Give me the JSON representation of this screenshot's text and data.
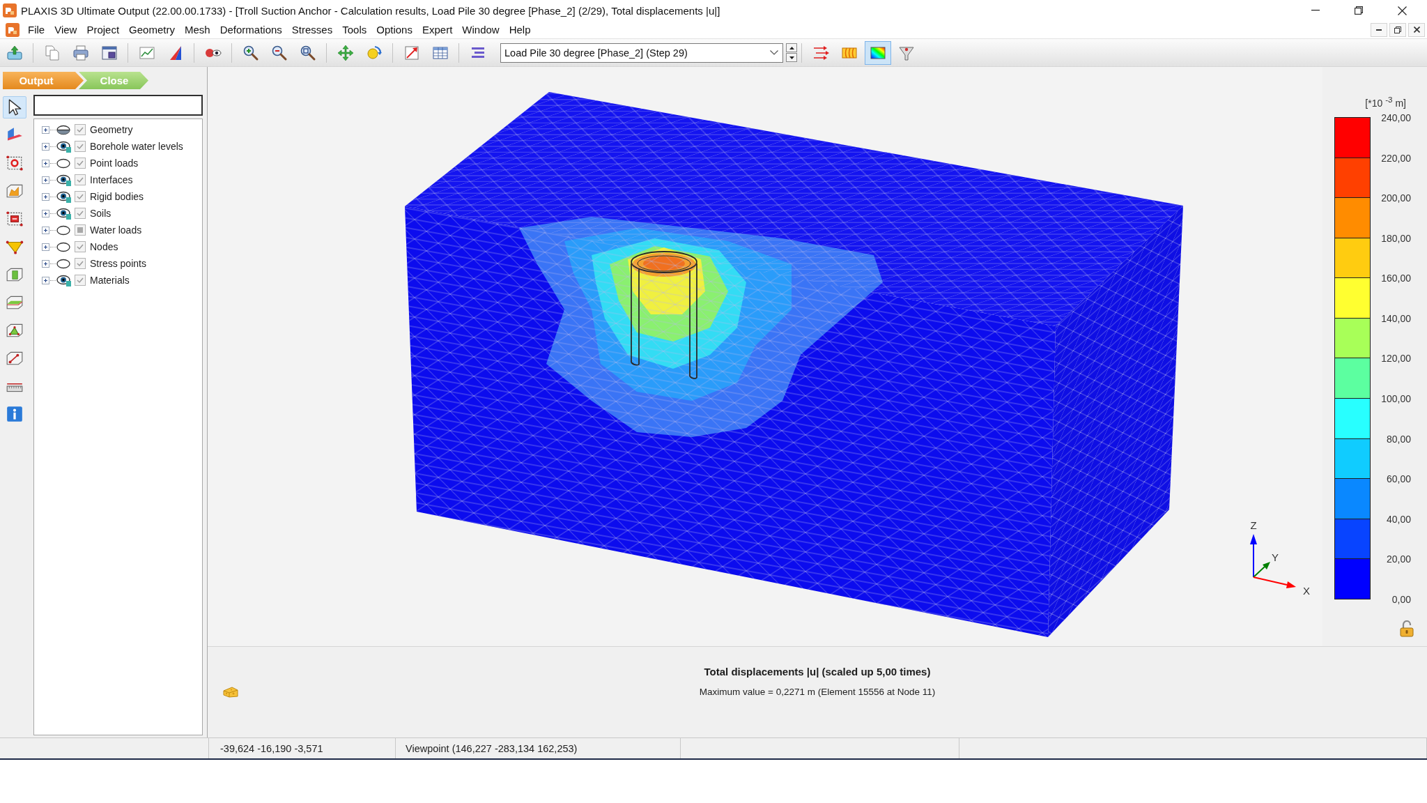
{
  "window": {
    "title": "PLAXIS 3D Ultimate Output (22.00.00.1733) - [Troll Suction Anchor - Calculation results, Load Pile 30 degree [Phase_2] (2/29), Total displacements |u|]"
  },
  "menu": [
    "File",
    "View",
    "Project",
    "Geometry",
    "Mesh",
    "Deformations",
    "Stresses",
    "Tools",
    "Options",
    "Expert",
    "Window",
    "Help"
  ],
  "toolbar": {
    "step_dropdown": {
      "value": "Load Pile 30 degree [Phase_2] (Step 29)"
    },
    "result_tools": [
      {
        "pressed": false
      },
      {
        "pressed": false
      },
      {
        "pressed": true
      },
      {
        "pressed": false
      }
    ]
  },
  "breadcrumb": [
    {
      "label": "Output",
      "selected": true
    },
    {
      "label": "Close",
      "selected": false
    }
  ],
  "side_tools": [
    {
      "selected": true
    },
    {
      "selected": false
    },
    {
      "selected": false
    },
    {
      "selected": false
    },
    {
      "selected": false
    },
    {
      "selected": false
    },
    {
      "selected": false
    },
    {
      "selected": false
    },
    {
      "selected": false
    },
    {
      "selected": false
    },
    {
      "selected": false
    },
    {
      "selected": false
    }
  ],
  "tree": {
    "items": [
      {
        "label": "Geometry",
        "expanded": false,
        "visible": false,
        "partial": true,
        "checked": true,
        "indeterminate": false
      },
      {
        "label": "Borehole water levels",
        "expanded": false,
        "visible": true,
        "partial": false,
        "checked": true,
        "indeterminate": false
      },
      {
        "label": "Point loads",
        "expanded": false,
        "visible": false,
        "partial": false,
        "checked": true,
        "indeterminate": false
      },
      {
        "label": "Interfaces",
        "expanded": false,
        "visible": true,
        "partial": false,
        "checked": true,
        "indeterminate": false
      },
      {
        "label": "Rigid bodies",
        "expanded": false,
        "visible": true,
        "partial": false,
        "checked": true,
        "indeterminate": false
      },
      {
        "label": "Soils",
        "expanded": false,
        "visible": true,
        "partial": false,
        "checked": true,
        "indeterminate": false
      },
      {
        "label": "Water loads",
        "expanded": false,
        "visible": false,
        "partial": false,
        "checked": false,
        "indeterminate": true
      },
      {
        "label": "Nodes",
        "expanded": false,
        "visible": false,
        "partial": false,
        "checked": true,
        "indeterminate": false
      },
      {
        "label": "Stress points",
        "expanded": false,
        "visible": false,
        "partial": false,
        "checked": true,
        "indeterminate": false
      },
      {
        "label": "Materials",
        "expanded": false,
        "visible": true,
        "partial": false,
        "checked": true,
        "indeterminate": false
      }
    ]
  },
  "viewport": {
    "axes": [
      {
        "label": "Z",
        "color": "#0000ff"
      },
      {
        "label": "Y",
        "color": "#008000"
      },
      {
        "label": "X",
        "color": "#ff0000"
      }
    ]
  },
  "legend": {
    "unit": "[*10 $^{-3}$ m]",
    "bands": [
      {
        "color": "#ff0000"
      },
      {
        "color": "#ff4000"
      },
      {
        "color": "#ff8c00"
      },
      {
        "color": "#ffcc10"
      },
      {
        "color": "#ffff30"
      },
      {
        "color": "#a8ff58"
      },
      {
        "color": "#5cffa0"
      },
      {
        "color": "#28ffff"
      },
      {
        "color": "#10ccff"
      },
      {
        "color": "#0a88ff"
      },
      {
        "color": "#0844ff"
      },
      {
        "color": "#0000ff"
      }
    ],
    "ticks": [
      "240,00",
      "220,00",
      "200,00",
      "180,00",
      "160,00",
      "140,00",
      "120,00",
      "100,00",
      "80,00",
      "60,00",
      "40,00",
      "20,00",
      "0,00"
    ]
  },
  "result_info": {
    "title": "Total displacements |u| (scaled up 5,00 times)",
    "maximum": "Maximum value = 0,2271 m (Element 15556 at Node 11)"
  },
  "status_bar": {
    "coordinates": "-39,624 -16,190 -3,571",
    "viewpoint": "Viewpoint (146,227 -283,134 162,253)"
  }
}
